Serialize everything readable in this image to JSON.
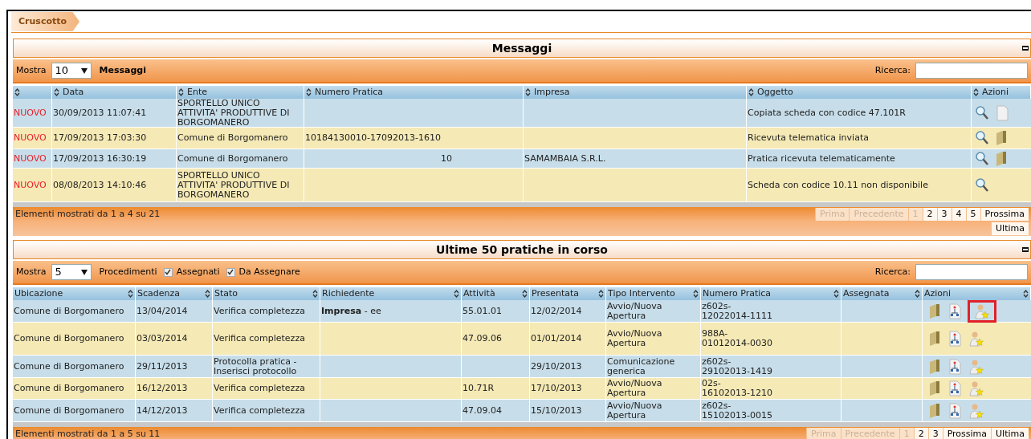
{
  "breadcrumb": "Cruscotto",
  "messages": {
    "title": "Messaggi",
    "show_label": "Mostra",
    "show_value": "10",
    "label": "Messaggi",
    "search_label": "Ricerca:",
    "columns": [
      "",
      "Data",
      "Ente",
      "Numero Pratica",
      "Impresa",
      "Oggetto",
      "Azioni"
    ],
    "rows": [
      {
        "cells": [
          "NUOVO",
          "30/09/2013 11:07:41",
          "SPORTELLO UNICO ATTIVITA' PRODUTTIVE DI BORGOMANERO",
          "",
          "",
          "Copiata scheda con codice 47.101R"
        ],
        "actions": [
          {
            "kind": "view",
            "highlighted": false
          },
          {
            "kind": "page",
            "highlighted": false
          }
        ]
      },
      {
        "cells": [
          "NUOVO",
          "17/09/2013 17:03:30",
          "Comune di Borgomanero",
          "10184130010-17092013-1610",
          "",
          "Ricevuta telematica inviata"
        ],
        "actions": [
          {
            "kind": "view",
            "highlighted": false
          },
          {
            "kind": "folder",
            "highlighted": false
          }
        ]
      },
      {
        "cells": [
          "NUOVO",
          "17/09/2013 16:30:19",
          "Comune di Borgomanero",
          "10",
          "SAMAMBAIA S.R.L.",
          "Pratica ricevuta telematicamente"
        ],
        "actions": [
          {
            "kind": "view",
            "highlighted": false
          },
          {
            "kind": "folder",
            "highlighted": false
          }
        ]
      },
      {
        "cells": [
          "NUOVO",
          "08/08/2013 14:10:46",
          "SPORTELLO UNICO ATTIVITA' PRODUTTIVE DI BORGOMANERO",
          "",
          "",
          "Scheda con codice 10.11 non disponibile"
        ],
        "actions": [
          {
            "kind": "view",
            "highlighted": false
          }
        ]
      }
    ],
    "summary": "Elementi mostrati da 1 a 4 su 21",
    "pager": [
      {
        "label": "Prima",
        "disabled": true
      },
      {
        "label": "Precedente",
        "disabled": true
      },
      {
        "label": "1",
        "disabled": true
      },
      {
        "label": "2",
        "disabled": false
      },
      {
        "label": "3",
        "disabled": false
      },
      {
        "label": "4",
        "disabled": false
      },
      {
        "label": "5",
        "disabled": false
      },
      {
        "label": "Prossima",
        "disabled": false
      },
      {
        "label": "Ultima",
        "disabled": false
      }
    ]
  },
  "practices": {
    "title": "Ultime 50 pratiche in corso",
    "show_label": "Mostra",
    "show_value": "5",
    "filter_label": "Procedimenti",
    "filters": [
      {
        "label": "Assegnati",
        "checked": true
      },
      {
        "label": "Da Assegnare",
        "checked": true
      }
    ],
    "search_label": "Ricerca:",
    "columns": [
      "Ubicazione",
      "Scadenza",
      "Stato",
      "Richiedente",
      "Attività",
      "Presentata",
      "Tipo Intervento",
      "Numero Pratica",
      "Assegnata",
      "Azioni"
    ],
    "rows": [
      {
        "cells": [
          "Comune di Borgomanero",
          "13/04/2014",
          "Verifica completezza",
          "**Impresa** - ee",
          "55.01.01",
          "12/02/2014",
          "Avvio/Nuova Apertura",
          "z602s-\n12022014-1111",
          ""
        ],
        "actions": [
          {
            "kind": "folder",
            "highlighted": false
          },
          {
            "kind": "flow",
            "highlighted": false
          },
          {
            "kind": "assign",
            "highlighted": true
          }
        ]
      },
      {
        "cells": [
          "Comune di Borgomanero",
          "03/03/2014",
          "Verifica completezza",
          "",
          "47.09.06",
          "01/01/2014",
          "Avvio/Nuova Apertura",
          "988A-\n01012014-0030",
          ""
        ],
        "actions": [
          {
            "kind": "folder",
            "highlighted": false
          },
          {
            "kind": "flow",
            "highlighted": false
          },
          {
            "kind": "assign",
            "highlighted": false
          }
        ]
      },
      {
        "cells": [
          "Comune di Borgomanero",
          "29/11/2013",
          "Protocolla pratica - Inserisci protocollo",
          "",
          "",
          "29/10/2013",
          "Comunicazione generica",
          "z602s-\n29102013-1419",
          ""
        ],
        "actions": [
          {
            "kind": "folder",
            "highlighted": false
          },
          {
            "kind": "flow",
            "highlighted": false
          },
          {
            "kind": "assign",
            "highlighted": false
          }
        ]
      },
      {
        "cells": [
          "Comune di Borgomanero",
          "16/12/2013",
          "Verifica completezza",
          "",
          "10.71R",
          "17/10/2013",
          "Avvio/Nuova Apertura",
          "02s-\n16102013-1210",
          ""
        ],
        "actions": [
          {
            "kind": "folder",
            "highlighted": false
          },
          {
            "kind": "flow",
            "highlighted": false
          },
          {
            "kind": "assign",
            "highlighted": false
          }
        ]
      },
      {
        "cells": [
          "Comune di Borgomanero",
          "14/12/2013",
          "Verifica completezza",
          "",
          "47.09.04",
          "15/10/2013",
          "Avvio/Nuova Apertura",
          "z602s-\n15102013-0015",
          ""
        ],
        "actions": [
          {
            "kind": "folder",
            "highlighted": false
          },
          {
            "kind": "flow",
            "highlighted": false
          },
          {
            "kind": "assign",
            "highlighted": false
          }
        ]
      }
    ],
    "summary": "Elementi mostrati da 1 a 5 su 11",
    "pager": [
      {
        "label": "Prima",
        "disabled": true
      },
      {
        "label": "Precedente",
        "disabled": true
      },
      {
        "label": "1",
        "disabled": true
      },
      {
        "label": "2",
        "disabled": false
      },
      {
        "label": "3",
        "disabled": false
      },
      {
        "label": "Prossima",
        "disabled": false
      },
      {
        "label": "Ultima",
        "disabled": false
      }
    ]
  }
}
